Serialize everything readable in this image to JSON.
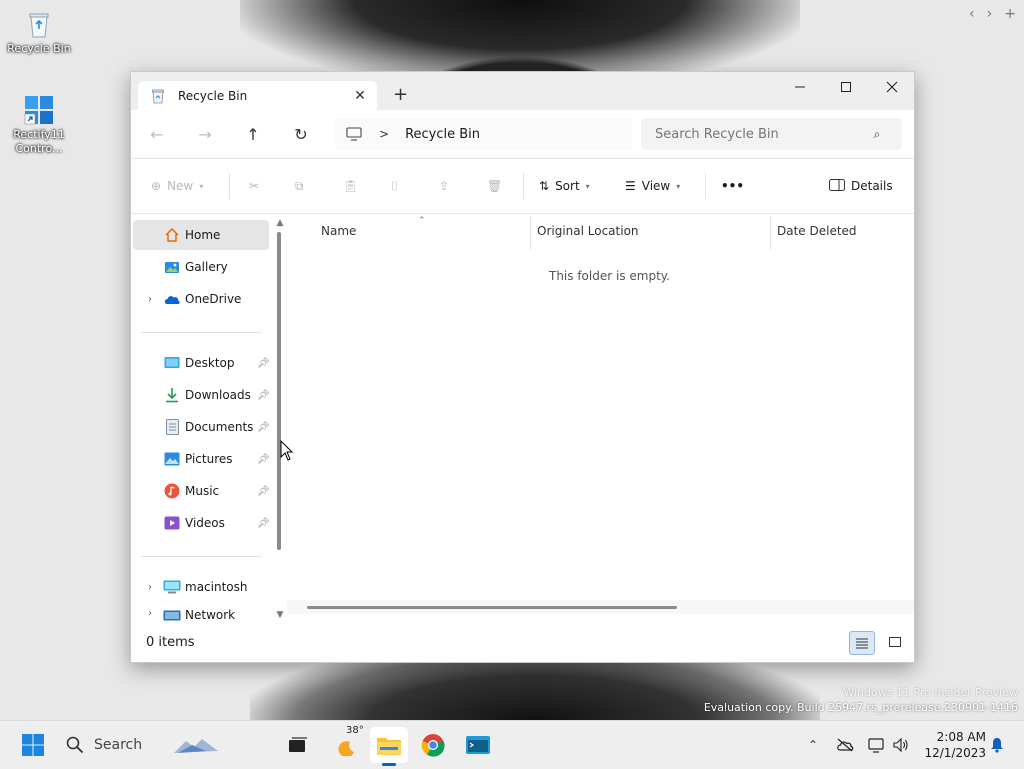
{
  "desktop": {
    "icons": [
      {
        "label": "Recycle Bin",
        "icon": "recycle-bin-icon"
      },
      {
        "label": "Rectify11 Contro...",
        "icon": "control-panel-icon"
      }
    ],
    "watermark": {
      "line1": "Windows 11 Pro Insider Preview",
      "line2": "Evaluation copy. Build 25947.rs_prerelease.230901-1416"
    }
  },
  "window": {
    "tab_title": "Recycle Bin",
    "new_tab_label": "+",
    "address": {
      "separator": ">",
      "location": "Recycle Bin"
    },
    "search": {
      "placeholder": "Search Recycle Bin"
    },
    "toolbar": {
      "new_label": "New",
      "sort_label": "Sort",
      "view_label": "View",
      "more_label": "•••",
      "details_label": "Details"
    },
    "nav_pane": {
      "items": [
        {
          "label": "Home",
          "icon": "home-icon",
          "selected": true
        },
        {
          "label": "Gallery",
          "icon": "gallery-icon"
        },
        {
          "label": "OneDrive",
          "icon": "onedrive-icon",
          "expandable": true
        },
        {
          "label": "Desktop",
          "icon": "desktop-folder-icon",
          "pinned": true
        },
        {
          "label": "Downloads",
          "icon": "downloads-icon",
          "pinned": true
        },
        {
          "label": "Documents",
          "icon": "documents-icon",
          "pinned": true
        },
        {
          "label": "Pictures",
          "icon": "pictures-icon",
          "pinned": true
        },
        {
          "label": "Music",
          "icon": "music-icon",
          "pinned": true
        },
        {
          "label": "Videos",
          "icon": "videos-icon",
          "pinned": true
        },
        {
          "label": "macintosh",
          "icon": "drive-icon",
          "expandable": true
        },
        {
          "label": "Network",
          "icon": "network-icon",
          "expandable": true
        }
      ]
    },
    "columns": [
      "Name",
      "Original Location",
      "Date Deleted"
    ],
    "empty_message": "This folder is empty.",
    "status": {
      "item_count": "0 items"
    }
  },
  "taskbar": {
    "search_label": "Search",
    "weather_temp": "38°",
    "time": "2:08 AM",
    "date": "12/1/2023"
  },
  "colors": {
    "accent": "#0067c0",
    "selected_bg": "#e5e5e5"
  }
}
